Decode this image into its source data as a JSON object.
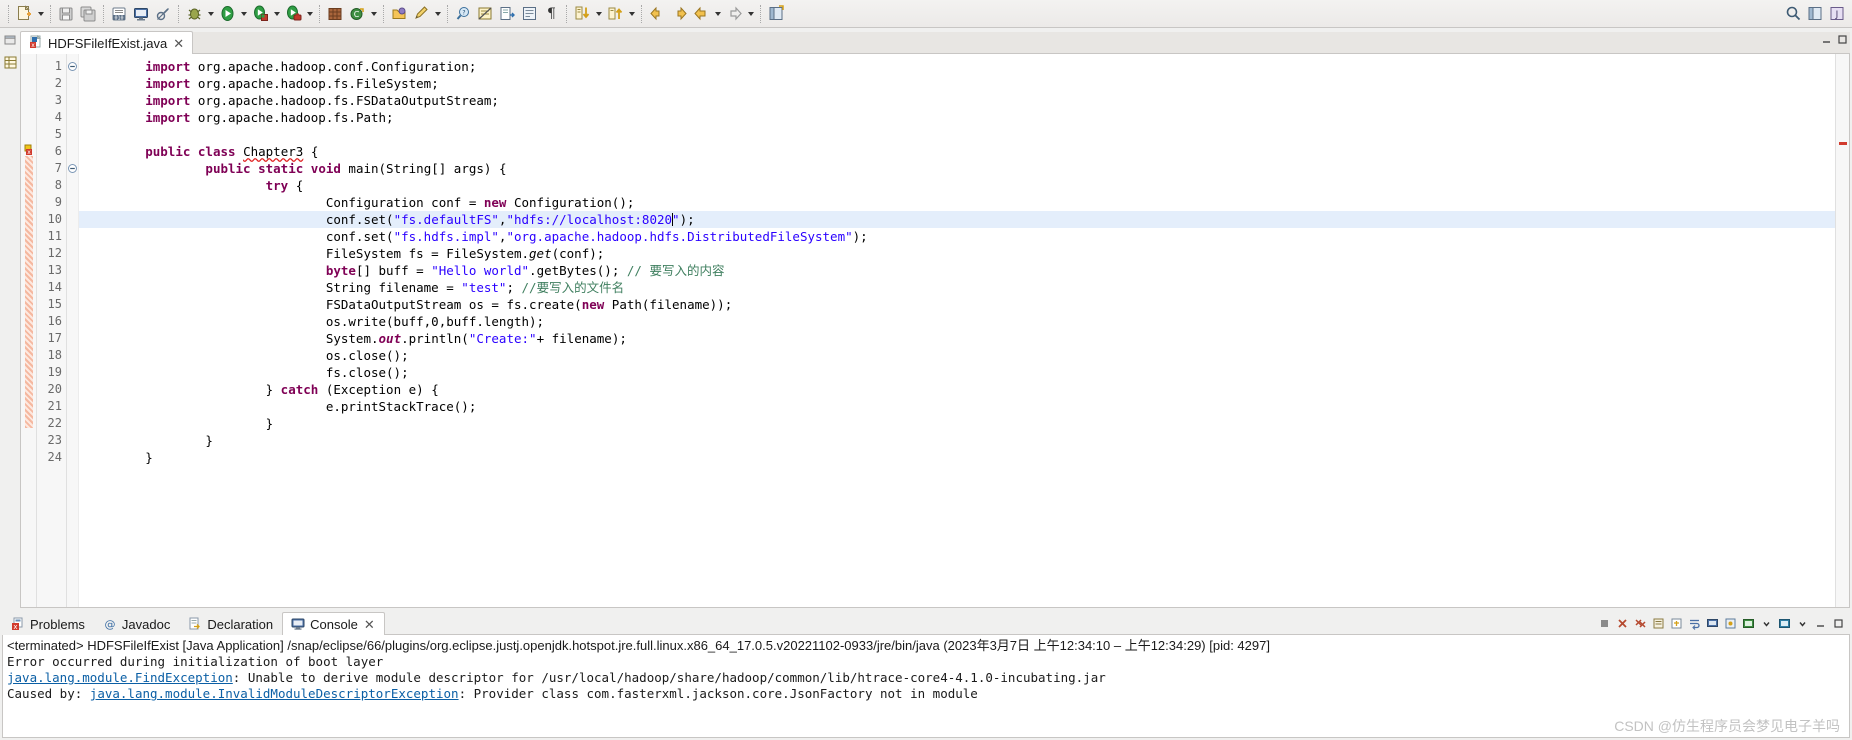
{
  "window": {
    "app": "Eclipse IDE"
  },
  "toolbar": {
    "items": [
      {
        "name": "new-wizard-button",
        "icon": "new-file-icon",
        "dropdown": true
      },
      {
        "name": "save-button",
        "icon": "save-icon",
        "dropdown": false
      },
      {
        "name": "save-all-button",
        "icon": "save-all-icon",
        "dropdown": false
      },
      {
        "name": "print-button",
        "icon": "print-icon",
        "dropdown": false
      },
      {
        "name": "open-console-button",
        "icon": "console-icon",
        "dropdown": false
      },
      {
        "name": "skip-breakpoints-button",
        "icon": "skip-breakpoints-icon",
        "dropdown": false
      },
      {
        "name": "debug-button",
        "icon": "debug-bug-icon",
        "dropdown": true
      },
      {
        "name": "run-button",
        "icon": "run-green-play-icon",
        "dropdown": true
      },
      {
        "name": "run-coverage-button",
        "icon": "coverage-icon",
        "dropdown": true
      },
      {
        "name": "run-external-tools-button",
        "icon": "external-tools-icon",
        "dropdown": true
      },
      {
        "name": "new-package-button",
        "icon": "package-icon",
        "dropdown": false
      },
      {
        "name": "new-java-class-button",
        "icon": "java-class-icon",
        "dropdown": true
      },
      {
        "name": "open-type-button",
        "icon": "open-type-icon",
        "dropdown": false
      },
      {
        "name": "search-button",
        "icon": "search-pencil-icon",
        "dropdown": true
      },
      {
        "name": "open-task-button",
        "icon": "task-icon",
        "dropdown": false
      },
      {
        "name": "toggle-mark-occurrences-button",
        "icon": "mark-occurrences-icon",
        "dropdown": false
      },
      {
        "name": "export-button",
        "icon": "export-icon",
        "dropdown": false
      },
      {
        "name": "toggle-block-selection-button",
        "icon": "block-selection-icon",
        "dropdown": false
      },
      {
        "name": "show-whitespace-button",
        "icon": "pilcrow-icon",
        "dropdown": false
      },
      {
        "name": "next-annotation-button",
        "icon": "next-annotation-icon",
        "dropdown": true
      },
      {
        "name": "previous-annotation-button",
        "icon": "previous-annotation-icon",
        "dropdown": true
      },
      {
        "name": "last-edit-location-button",
        "icon": "last-edit-location-icon",
        "dropdown": false
      },
      {
        "name": "back-button",
        "icon": "back-arrow-icon",
        "dropdown": false
      },
      {
        "name": "forward-button",
        "icon": "forward-arrow-icon",
        "dropdown": true
      },
      {
        "name": "pin-editor-button",
        "icon": "pin-editor-icon",
        "dropdown": true
      },
      {
        "name": "new-perspective-button",
        "icon": "perspective-icon",
        "dropdown": false
      }
    ],
    "right_items": [
      {
        "name": "quick-access-search-button",
        "icon": "search-icon"
      },
      {
        "name": "open-perspective-button",
        "icon": "open-perspective-icon"
      },
      {
        "name": "java-perspective-button",
        "icon": "java-perspective-icon"
      }
    ]
  },
  "editor": {
    "tab": {
      "label": "HDFSFileIfExist.java",
      "icon": "java-file-error-icon",
      "close_label": "✕",
      "dirty": false
    },
    "window_controls": {
      "minimize": "minimize-icon",
      "maximize": "maximize-icon",
      "restore": "restore-icon"
    },
    "cursor_line": 10,
    "total_lines": 24,
    "line_numbers": [
      "1",
      "2",
      "3",
      "4",
      "5",
      "6",
      "7",
      "8",
      "9",
      "10",
      "11",
      "12",
      "13",
      "14",
      "15",
      "16",
      "17",
      "18",
      "19",
      "20",
      "21",
      "22",
      "23",
      "24"
    ],
    "folding": {
      "1": "collapse",
      "7": "collapse"
    },
    "markers": [
      {
        "line": 6,
        "type": "error-warning-marker"
      },
      {
        "line": 7,
        "type": "problem-stripe"
      }
    ],
    "code_lines": [
      {
        "n": 1,
        "tokens": [
          {
            "t": "        ",
            "c": "plain"
          },
          {
            "t": "import",
            "c": "kw"
          },
          {
            "t": " org.apache.hadoop.conf.Configuration;",
            "c": "plain"
          }
        ]
      },
      {
        "n": 2,
        "tokens": [
          {
            "t": "        ",
            "c": "plain"
          },
          {
            "t": "import",
            "c": "kw"
          },
          {
            "t": " org.apache.hadoop.fs.FileSystem;",
            "c": "plain"
          }
        ]
      },
      {
        "n": 3,
        "tokens": [
          {
            "t": "        ",
            "c": "plain"
          },
          {
            "t": "import",
            "c": "kw"
          },
          {
            "t": " org.apache.hadoop.fs.FSDataOutputStream;",
            "c": "plain"
          }
        ]
      },
      {
        "n": 4,
        "tokens": [
          {
            "t": "        ",
            "c": "plain"
          },
          {
            "t": "import",
            "c": "kw"
          },
          {
            "t": " org.apache.hadoop.fs.Path;",
            "c": "plain"
          }
        ]
      },
      {
        "n": 5,
        "tokens": []
      },
      {
        "n": 6,
        "tokens": [
          {
            "t": "        ",
            "c": "plain"
          },
          {
            "t": "public",
            "c": "kw"
          },
          {
            "t": " ",
            "c": "plain"
          },
          {
            "t": "class",
            "c": "kw"
          },
          {
            "t": " ",
            "c": "plain"
          },
          {
            "t": "Chapter3",
            "c": "err-underline"
          },
          {
            "t": " {",
            "c": "plain"
          }
        ]
      },
      {
        "n": 7,
        "tokens": [
          {
            "t": "                ",
            "c": "plain"
          },
          {
            "t": "public",
            "c": "kw"
          },
          {
            "t": " ",
            "c": "plain"
          },
          {
            "t": "static",
            "c": "kw"
          },
          {
            "t": " ",
            "c": "plain"
          },
          {
            "t": "void",
            "c": "kw"
          },
          {
            "t": " main(String[] args) {",
            "c": "plain"
          }
        ]
      },
      {
        "n": 8,
        "tokens": [
          {
            "t": "                        ",
            "c": "plain"
          },
          {
            "t": "try",
            "c": "kw"
          },
          {
            "t": " {",
            "c": "plain"
          }
        ]
      },
      {
        "n": 9,
        "tokens": [
          {
            "t": "                                ",
            "c": "plain"
          },
          {
            "t": "Configuration conf = ",
            "c": "plain"
          },
          {
            "t": "new",
            "c": "kw"
          },
          {
            "t": " Configuration();",
            "c": "plain"
          }
        ]
      },
      {
        "n": 10,
        "tokens": [
          {
            "t": "                                ",
            "c": "plain"
          },
          {
            "t": "conf.set(",
            "c": "plain"
          },
          {
            "t": "\"fs.defaultFS\"",
            "c": "str"
          },
          {
            "t": ",",
            "c": "plain"
          },
          {
            "t": "\"hdfs://localhost:8020",
            "c": "str"
          },
          {
            "t": "CARET",
            "c": "caret"
          },
          {
            "t": "\"",
            "c": "str"
          },
          {
            "t": ");",
            "c": "plain"
          }
        ],
        "highlight": true
      },
      {
        "n": 11,
        "tokens": [
          {
            "t": "                                ",
            "c": "plain"
          },
          {
            "t": "conf.set(",
            "c": "plain"
          },
          {
            "t": "\"fs.hdfs.impl\"",
            "c": "str"
          },
          {
            "t": ",",
            "c": "plain"
          },
          {
            "t": "\"org.apache.hadoop.hdfs.DistributedFileSystem\"",
            "c": "str"
          },
          {
            "t": ");",
            "c": "plain"
          }
        ]
      },
      {
        "n": 12,
        "tokens": [
          {
            "t": "                                ",
            "c": "plain"
          },
          {
            "t": "FileSystem fs = FileSystem.",
            "c": "plain"
          },
          {
            "t": "get",
            "c": "stat"
          },
          {
            "t": "(conf);",
            "c": "plain"
          }
        ]
      },
      {
        "n": 13,
        "tokens": [
          {
            "t": "                                ",
            "c": "plain"
          },
          {
            "t": "byte",
            "c": "kw"
          },
          {
            "t": "[] buff = ",
            "c": "plain"
          },
          {
            "t": "\"Hello world\"",
            "c": "str"
          },
          {
            "t": ".getBytes(); ",
            "c": "plain"
          },
          {
            "t": "// 要写入的内容",
            "c": "cmt"
          }
        ]
      },
      {
        "n": 14,
        "tokens": [
          {
            "t": "                                ",
            "c": "plain"
          },
          {
            "t": "String filename = ",
            "c": "plain"
          },
          {
            "t": "\"test\"",
            "c": "str"
          },
          {
            "t": "; ",
            "c": "plain"
          },
          {
            "t": "//要写入的文件名",
            "c": "cmt"
          }
        ]
      },
      {
        "n": 15,
        "tokens": [
          {
            "t": "                                ",
            "c": "plain"
          },
          {
            "t": "FSDataOutputStream os = fs.create(",
            "c": "plain"
          },
          {
            "t": "new",
            "c": "kw"
          },
          {
            "t": " Path(filename));",
            "c": "plain"
          }
        ]
      },
      {
        "n": 16,
        "tokens": [
          {
            "t": "                                ",
            "c": "plain"
          },
          {
            "t": "os.write(buff,0,buff.length);",
            "c": "plain"
          }
        ]
      },
      {
        "n": 17,
        "tokens": [
          {
            "t": "                                ",
            "c": "plain"
          },
          {
            "t": "System.",
            "c": "plain"
          },
          {
            "t": "out",
            "c": "stat-bold"
          },
          {
            "t": ".println(",
            "c": "plain"
          },
          {
            "t": "\"Create:\"",
            "c": "str"
          },
          {
            "t": "+ filename);",
            "c": "plain"
          }
        ]
      },
      {
        "n": 18,
        "tokens": [
          {
            "t": "                                ",
            "c": "plain"
          },
          {
            "t": "os.close();",
            "c": "plain"
          }
        ]
      },
      {
        "n": 19,
        "tokens": [
          {
            "t": "                                ",
            "c": "plain"
          },
          {
            "t": "fs.close();",
            "c": "plain"
          }
        ]
      },
      {
        "n": 20,
        "tokens": [
          {
            "t": "                        } ",
            "c": "plain"
          },
          {
            "t": "catch",
            "c": "kw"
          },
          {
            "t": " (Exception e) {",
            "c": "plain"
          }
        ]
      },
      {
        "n": 21,
        "tokens": [
          {
            "t": "                                ",
            "c": "plain"
          },
          {
            "t": "e.printStackTrace();",
            "c": "plain"
          }
        ]
      },
      {
        "n": 22,
        "tokens": [
          {
            "t": "                        }",
            "c": "plain"
          }
        ]
      },
      {
        "n": 23,
        "tokens": [
          {
            "t": "                }",
            "c": "plain"
          }
        ]
      },
      {
        "n": 24,
        "tokens": [
          {
            "t": "        }",
            "c": "plain"
          }
        ]
      }
    ]
  },
  "bottom_panel": {
    "tabs": [
      {
        "label": "Problems",
        "icon": "problems-icon",
        "active": false,
        "closable": false
      },
      {
        "label": "Javadoc",
        "icon": "javadoc-at-icon",
        "active": false,
        "closable": false
      },
      {
        "label": "Declaration",
        "icon": "declaration-icon",
        "active": false,
        "closable": false
      },
      {
        "label": "Console",
        "icon": "console-icon",
        "active": true,
        "closable": true
      }
    ],
    "close_label": "✕",
    "tools": [
      {
        "name": "terminate-button",
        "icon": "terminate-stop-icon"
      },
      {
        "name": "remove-launch-button",
        "icon": "remove-launch-icon"
      },
      {
        "name": "remove-all-terminated-button",
        "icon": "remove-all-terminated-icon"
      },
      {
        "name": "clear-console-button",
        "icon": "clear-console-icon"
      },
      {
        "name": "scroll-lock-button",
        "icon": "scroll-lock-icon"
      },
      {
        "name": "word-wrap-button",
        "icon": "word-wrap-icon"
      },
      {
        "name": "show-console-on-output-button",
        "icon": "show-console-output-icon"
      },
      {
        "name": "pin-console-button",
        "icon": "pin-console-icon"
      },
      {
        "name": "display-selected-console-button",
        "icon": "display-console-icon"
      },
      {
        "name": "display-selected-console-dropdown",
        "icon": "chevron-down-icon"
      },
      {
        "name": "open-console-button",
        "icon": "open-console-icon"
      },
      {
        "name": "open-console-dropdown",
        "icon": "chevron-down-icon"
      },
      {
        "name": "minimize-panel-button",
        "icon": "minimize-icon"
      },
      {
        "name": "maximize-panel-button",
        "icon": "maximize-icon"
      }
    ],
    "console": {
      "header": "<terminated> HDFSFileIfExist [Java Application] /snap/eclipse/66/plugins/org.eclipse.justj.openjdk.hotspot.jre.full.linux.x86_64_17.0.5.v20221102-0933/jre/bin/java (2023年3月7日 上午12:34:10 – 上午12:34:29) [pid: 4297]",
      "lines": [
        {
          "segments": [
            {
              "text": "Error occurred during initialization of boot layer",
              "link": false
            }
          ]
        },
        {
          "segments": [
            {
              "text": "java.lang.module.FindException",
              "link": true
            },
            {
              "text": ": Unable to derive module descriptor for /usr/local/hadoop/share/hadoop/common/lib/htrace-core4-4.1.0-incubating.jar",
              "link": false
            }
          ]
        },
        {
          "segments": [
            {
              "text": "Caused by: ",
              "link": false
            },
            {
              "text": "java.lang.module.InvalidModuleDescriptorException",
              "link": true
            },
            {
              "text": ": Provider class com.fasterxml.jackson.core.JsonFactory not in module",
              "link": false
            }
          ]
        }
      ]
    }
  },
  "watermark": {
    "text": "CSDN @仿生程序员会梦见电子羊吗"
  },
  "colors": {
    "keyword": "#7f0055",
    "string": "#2a00ff",
    "comment": "#3f7f5f",
    "link": "#0b5fa5",
    "highlight_line": "#e4eefb",
    "toolbar_bg": "#f0f0ef",
    "error": "#e02020"
  }
}
